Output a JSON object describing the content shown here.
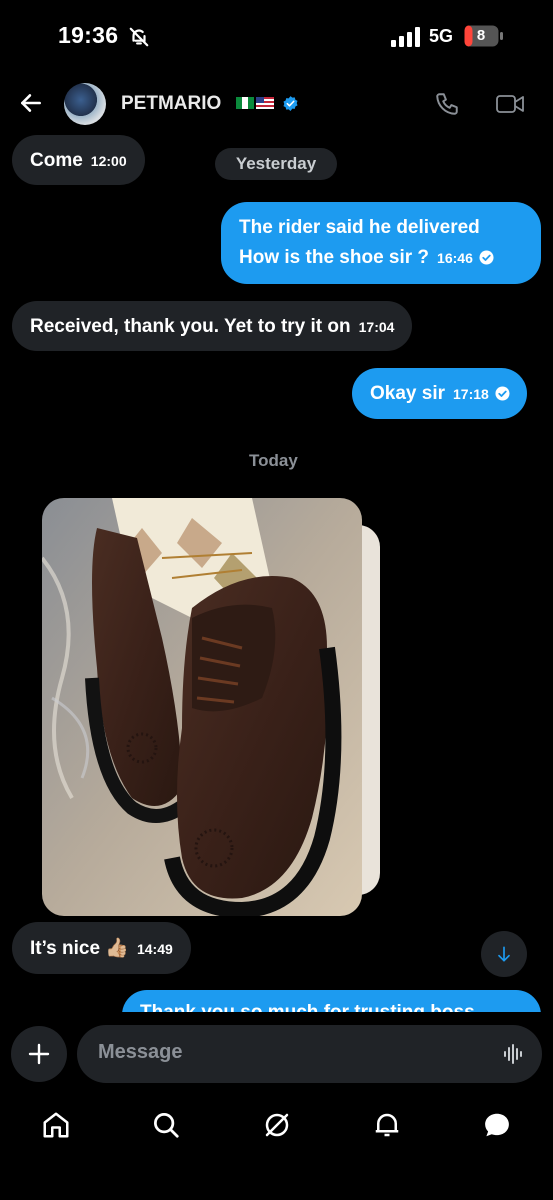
{
  "status_bar": {
    "time": "19:36",
    "network": "5G",
    "battery": "8"
  },
  "header": {
    "contact_name": "PETMARIO"
  },
  "messages": [
    {
      "side": "in",
      "text": "Come",
      "time": "12:00"
    },
    {
      "side": "out",
      "lines": [
        "The rider said he delivered",
        "How is the shoe sir ?"
      ],
      "time": "16:46"
    },
    {
      "side": "in",
      "text": "Received, thank you. Yet to try it on",
      "time": "17:04"
    },
    {
      "side": "out",
      "text": "Okay sir",
      "time": "17:18"
    },
    {
      "side": "in",
      "text": "It’s nice 👍🏼",
      "time": "14:49"
    },
    {
      "side": "out",
      "text": "Thank you so much for trusting boss"
    }
  ],
  "day_dividers": {
    "yesterday": "Yesterday",
    "today": "Today"
  },
  "composer": {
    "placeholder": "Message"
  },
  "colors": {
    "accent": "#1d9bf0",
    "incoming_bubble": "#202327",
    "background": "#000000"
  },
  "icons": [
    "back-arrow-icon",
    "verified-badge-icon",
    "phone-icon",
    "video-camera-icon",
    "bell-off-icon",
    "read-check-icon",
    "arrow-down-icon",
    "plus-icon",
    "voice-wave-icon",
    "home-icon",
    "search-icon",
    "grok-icon",
    "notifications-icon",
    "messages-icon"
  ]
}
